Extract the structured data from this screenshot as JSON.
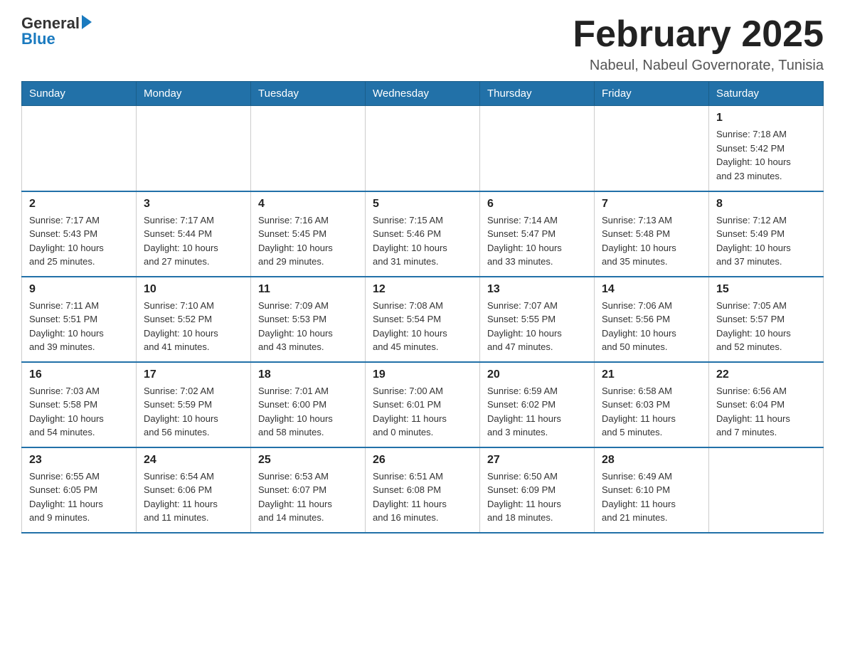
{
  "header": {
    "title": "February 2025",
    "location": "Nabeul, Nabeul Governorate, Tunisia",
    "logo_general": "General",
    "logo_blue": "Blue"
  },
  "days_of_week": [
    "Sunday",
    "Monday",
    "Tuesday",
    "Wednesday",
    "Thursday",
    "Friday",
    "Saturday"
  ],
  "weeks": [
    [
      {
        "day": "",
        "info": ""
      },
      {
        "day": "",
        "info": ""
      },
      {
        "day": "",
        "info": ""
      },
      {
        "day": "",
        "info": ""
      },
      {
        "day": "",
        "info": ""
      },
      {
        "day": "",
        "info": ""
      },
      {
        "day": "1",
        "info": "Sunrise: 7:18 AM\nSunset: 5:42 PM\nDaylight: 10 hours\nand 23 minutes."
      }
    ],
    [
      {
        "day": "2",
        "info": "Sunrise: 7:17 AM\nSunset: 5:43 PM\nDaylight: 10 hours\nand 25 minutes."
      },
      {
        "day": "3",
        "info": "Sunrise: 7:17 AM\nSunset: 5:44 PM\nDaylight: 10 hours\nand 27 minutes."
      },
      {
        "day": "4",
        "info": "Sunrise: 7:16 AM\nSunset: 5:45 PM\nDaylight: 10 hours\nand 29 minutes."
      },
      {
        "day": "5",
        "info": "Sunrise: 7:15 AM\nSunset: 5:46 PM\nDaylight: 10 hours\nand 31 minutes."
      },
      {
        "day": "6",
        "info": "Sunrise: 7:14 AM\nSunset: 5:47 PM\nDaylight: 10 hours\nand 33 minutes."
      },
      {
        "day": "7",
        "info": "Sunrise: 7:13 AM\nSunset: 5:48 PM\nDaylight: 10 hours\nand 35 minutes."
      },
      {
        "day": "8",
        "info": "Sunrise: 7:12 AM\nSunset: 5:49 PM\nDaylight: 10 hours\nand 37 minutes."
      }
    ],
    [
      {
        "day": "9",
        "info": "Sunrise: 7:11 AM\nSunset: 5:51 PM\nDaylight: 10 hours\nand 39 minutes."
      },
      {
        "day": "10",
        "info": "Sunrise: 7:10 AM\nSunset: 5:52 PM\nDaylight: 10 hours\nand 41 minutes."
      },
      {
        "day": "11",
        "info": "Sunrise: 7:09 AM\nSunset: 5:53 PM\nDaylight: 10 hours\nand 43 minutes."
      },
      {
        "day": "12",
        "info": "Sunrise: 7:08 AM\nSunset: 5:54 PM\nDaylight: 10 hours\nand 45 minutes."
      },
      {
        "day": "13",
        "info": "Sunrise: 7:07 AM\nSunset: 5:55 PM\nDaylight: 10 hours\nand 47 minutes."
      },
      {
        "day": "14",
        "info": "Sunrise: 7:06 AM\nSunset: 5:56 PM\nDaylight: 10 hours\nand 50 minutes."
      },
      {
        "day": "15",
        "info": "Sunrise: 7:05 AM\nSunset: 5:57 PM\nDaylight: 10 hours\nand 52 minutes."
      }
    ],
    [
      {
        "day": "16",
        "info": "Sunrise: 7:03 AM\nSunset: 5:58 PM\nDaylight: 10 hours\nand 54 minutes."
      },
      {
        "day": "17",
        "info": "Sunrise: 7:02 AM\nSunset: 5:59 PM\nDaylight: 10 hours\nand 56 minutes."
      },
      {
        "day": "18",
        "info": "Sunrise: 7:01 AM\nSunset: 6:00 PM\nDaylight: 10 hours\nand 58 minutes."
      },
      {
        "day": "19",
        "info": "Sunrise: 7:00 AM\nSunset: 6:01 PM\nDaylight: 11 hours\nand 0 minutes."
      },
      {
        "day": "20",
        "info": "Sunrise: 6:59 AM\nSunset: 6:02 PM\nDaylight: 11 hours\nand 3 minutes."
      },
      {
        "day": "21",
        "info": "Sunrise: 6:58 AM\nSunset: 6:03 PM\nDaylight: 11 hours\nand 5 minutes."
      },
      {
        "day": "22",
        "info": "Sunrise: 6:56 AM\nSunset: 6:04 PM\nDaylight: 11 hours\nand 7 minutes."
      }
    ],
    [
      {
        "day": "23",
        "info": "Sunrise: 6:55 AM\nSunset: 6:05 PM\nDaylight: 11 hours\nand 9 minutes."
      },
      {
        "day": "24",
        "info": "Sunrise: 6:54 AM\nSunset: 6:06 PM\nDaylight: 11 hours\nand 11 minutes."
      },
      {
        "day": "25",
        "info": "Sunrise: 6:53 AM\nSunset: 6:07 PM\nDaylight: 11 hours\nand 14 minutes."
      },
      {
        "day": "26",
        "info": "Sunrise: 6:51 AM\nSunset: 6:08 PM\nDaylight: 11 hours\nand 16 minutes."
      },
      {
        "day": "27",
        "info": "Sunrise: 6:50 AM\nSunset: 6:09 PM\nDaylight: 11 hours\nand 18 minutes."
      },
      {
        "day": "28",
        "info": "Sunrise: 6:49 AM\nSunset: 6:10 PM\nDaylight: 11 hours\nand 21 minutes."
      },
      {
        "day": "",
        "info": ""
      }
    ]
  ]
}
